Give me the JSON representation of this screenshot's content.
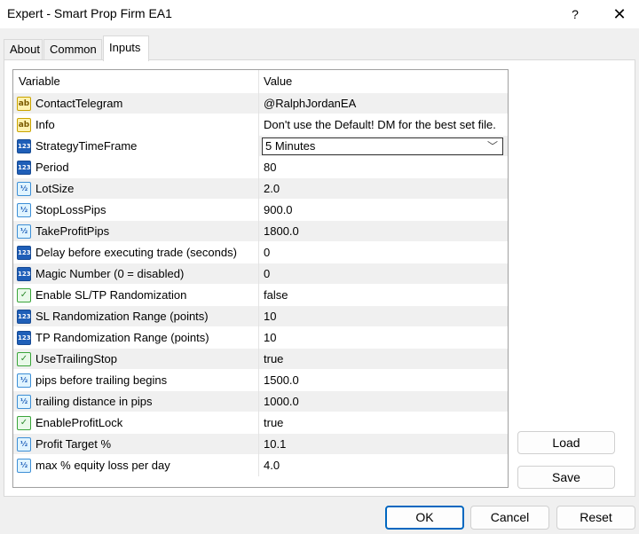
{
  "window": {
    "title": "Expert - Smart Prop Firm EA1",
    "help": "?",
    "close": "✕"
  },
  "tabs": [
    {
      "label": "About"
    },
    {
      "label": "Common"
    },
    {
      "label": "Inputs"
    }
  ],
  "grid": {
    "header": {
      "variable": "Variable",
      "value": "Value"
    },
    "rows": [
      {
        "type": "text",
        "icon": "ab",
        "variable": "ContactTelegram",
        "value": "@RalphJordanEA"
      },
      {
        "type": "text",
        "icon": "ab",
        "variable": "Info",
        "value": "Don't use the Default! DM for the best set file."
      },
      {
        "type": "int",
        "icon": "123",
        "variable": "StrategyTimeFrame",
        "value": "5 Minutes",
        "dropdown": true
      },
      {
        "type": "int",
        "icon": "123",
        "variable": "Period",
        "value": "80"
      },
      {
        "type": "double",
        "icon": "½",
        "variable": "LotSize",
        "value": "2.0"
      },
      {
        "type": "double",
        "icon": "½",
        "variable": "StopLossPips",
        "value": "900.0"
      },
      {
        "type": "double",
        "icon": "½",
        "variable": "TakeProfitPips",
        "value": "1800.0"
      },
      {
        "type": "int",
        "icon": "123",
        "variable": "Delay before executing trade (seconds)",
        "value": "0"
      },
      {
        "type": "int",
        "icon": "123",
        "variable": "Magic Number (0 = disabled)",
        "value": "0"
      },
      {
        "type": "bool",
        "icon": "✓",
        "variable": "Enable SL/TP Randomization",
        "value": "false"
      },
      {
        "type": "int",
        "icon": "123",
        "variable": "SL Randomization Range (points)",
        "value": "10"
      },
      {
        "type": "int",
        "icon": "123",
        "variable": "TP Randomization Range (points)",
        "value": "10"
      },
      {
        "type": "bool",
        "icon": "✓",
        "variable": "UseTrailingStop",
        "value": "true"
      },
      {
        "type": "double",
        "icon": "½",
        "variable": "pips before trailing begins",
        "value": "1500.0"
      },
      {
        "type": "double",
        "icon": "½",
        "variable": "trailing distance in pips",
        "value": "1000.0"
      },
      {
        "type": "bool",
        "icon": "✓",
        "variable": "EnableProfitLock",
        "value": "true"
      },
      {
        "type": "double",
        "icon": "½",
        "variable": "Profit Target %",
        "value": "10.1"
      },
      {
        "type": "double",
        "icon": "½",
        "variable": "max % equity loss per day",
        "value": "4.0"
      }
    ]
  },
  "side_buttons": {
    "load": "Load",
    "save": "Save"
  },
  "footer": {
    "ok": "OK",
    "cancel": "Cancel",
    "reset": "Reset"
  },
  "dropdown_chevron": "﹀"
}
